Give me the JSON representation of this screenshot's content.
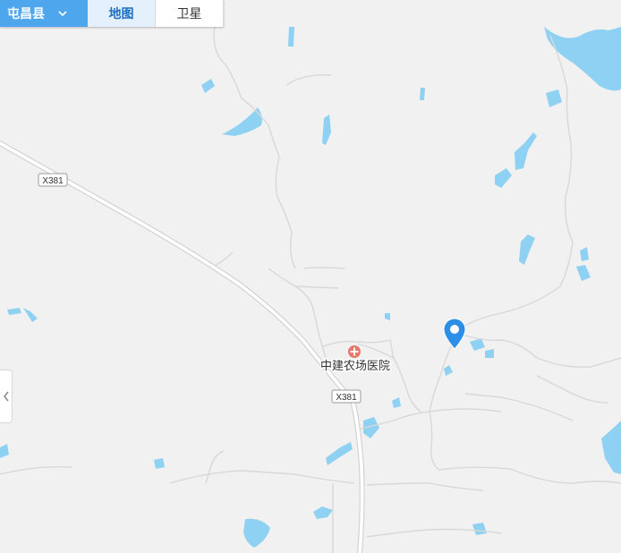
{
  "toolbar": {
    "region": "屯昌县",
    "tabs": [
      "地图",
      "卫星"
    ]
  },
  "map": {
    "roads": [
      "X381",
      "X381"
    ],
    "poi": {
      "name": "中建农场医院",
      "icon": "hospital-icon"
    },
    "marker": "location-pin-icon"
  },
  "colors": {
    "water": "#8fd1f2",
    "land": "#f1f1f1",
    "road": "#ffffff",
    "accent": "#4ea7ec",
    "poi": "#e8776f"
  }
}
